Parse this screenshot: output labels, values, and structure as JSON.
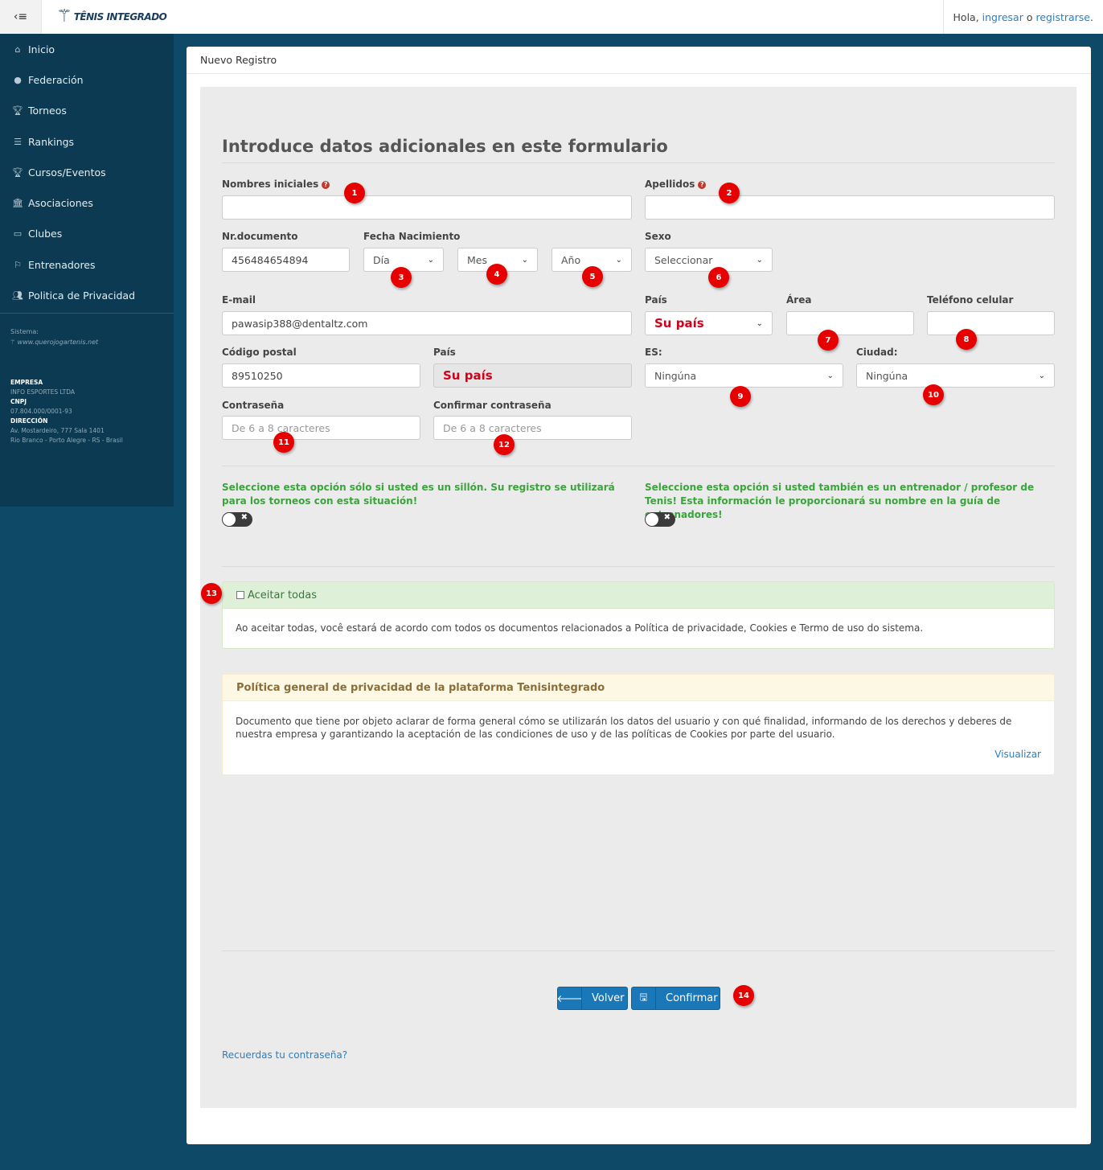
{
  "header": {
    "toggle_icon": "‹≡",
    "brand": "TÊNIS INTEGRADO",
    "greeting": "Hola,",
    "login_link": "ingresar",
    "or": "o",
    "register_link": "registrarse",
    "period": "."
  },
  "sidebar": {
    "items": [
      {
        "label": "Inicio",
        "icon": "home-icon"
      },
      {
        "label": "Federación",
        "icon": "globe-icon"
      },
      {
        "label": "Torneos",
        "icon": "trophy-icon"
      },
      {
        "label": "Rankings",
        "icon": "list-icon"
      },
      {
        "label": "Cursos/Eventos",
        "icon": "trophy-icon"
      },
      {
        "label": "Asociaciones",
        "icon": "bank-icon"
      },
      {
        "label": "Clubes",
        "icon": "folder-icon"
      },
      {
        "label": "Entrenadores",
        "icon": "flag-icon"
      },
      {
        "label": "Politica de Privacidad",
        "icon": "users-icon"
      }
    ],
    "system_label": "Sistema:",
    "system_logo": "www.querojogartenis.net",
    "company_title": "EMPRESA",
    "company_name": "INFO ESPORTES LTDA",
    "cnpj_title": "CNPJ",
    "cnpj_value": "07.804.000/0001-93",
    "address_title": "DIRECCIÓN",
    "address_line1": "Av. Mostardeiro, 777 Sala 1401",
    "address_line2": "Rio Branco - Porto Alegre - RS - Brasil"
  },
  "card": {
    "title": "Nuevo Registro"
  },
  "form": {
    "heading": "Introduce datos adicionales en este formulario",
    "first_names_label": "Nombres iniciales",
    "first_names_value": "",
    "last_names_label": "Apellidos",
    "last_names_value": "",
    "document_label": "Nr.documento",
    "document_value": "456484654894",
    "birth_label": "Fecha Nacimiento",
    "day_selected": "Día",
    "month_selected": "Mes",
    "year_selected": "Año",
    "sex_label": "Sexo",
    "sex_selected": "Seleccionar",
    "email_label": "E-mail",
    "email_value": "pawasip388@dentaltz.com",
    "country_label": "País",
    "country_selected": "Su país",
    "area_label": "Área",
    "area_value": "",
    "mobile_label": "Teléfono celular",
    "mobile_value": "",
    "postal_label": "Código postal",
    "postal_value": "89510250",
    "country2_label": "País",
    "country2_value": "Su país",
    "state_label": "ES:",
    "state_selected": "Ningúna",
    "city_label": "Ciudad:",
    "city_selected": "Ningúna",
    "password_label": "Contraseña",
    "password_placeholder": "De 6 a 8 caracteres",
    "confirm_label": "Confirmar contraseña",
    "confirm_placeholder": "De 6 a 8 caracteres",
    "wheelchair_note": "Seleccione esta opción sólo si usted es un sillón. Su registro se utilizará para los torneos con esta situación!",
    "coach_note": "Seleccione esta opción si usted también es un entrenador / profesor de Tenis! Esta información le proporcionará su nombre en la guía de entrenadores!",
    "toggle_x": "✖"
  },
  "consent": {
    "accept_all_label": "Aceitar todas",
    "accept_all_text": "Ao aceitar todas, você estará de acordo com todos os documentos relacionados a Política de privacidade, Cookies e Termo de uso do sistema."
  },
  "privacy": {
    "title": "Política general de privacidad de la plataforma Tenisintegrado",
    "text": "Documento que tiene por objeto aclarar de forma general cómo se utilizarán los datos del usuario y con qué finalidad, informando de los derechos y deberes de nuestra empresa y garantizando la aceptación de las condiciones de uso y de las políticas de Cookies por parte del usuario.",
    "view_link": "Visualizar"
  },
  "actions": {
    "back_label": "Volver",
    "confirm_label": "Confirmar",
    "forgot_link": "Recuerdas tu contraseña?"
  },
  "badges": [
    "1",
    "2",
    "3",
    "4",
    "5",
    "6",
    "7",
    "8",
    "9",
    "10",
    "11",
    "12",
    "13",
    "14"
  ],
  "colors": {
    "sidebar": "#0c3a52",
    "background": "#0e4a67",
    "primary_button": "#1a78b8",
    "badge_red": "#e60000",
    "note_green": "#3aa53a",
    "link_blue": "#2a7fbf"
  }
}
